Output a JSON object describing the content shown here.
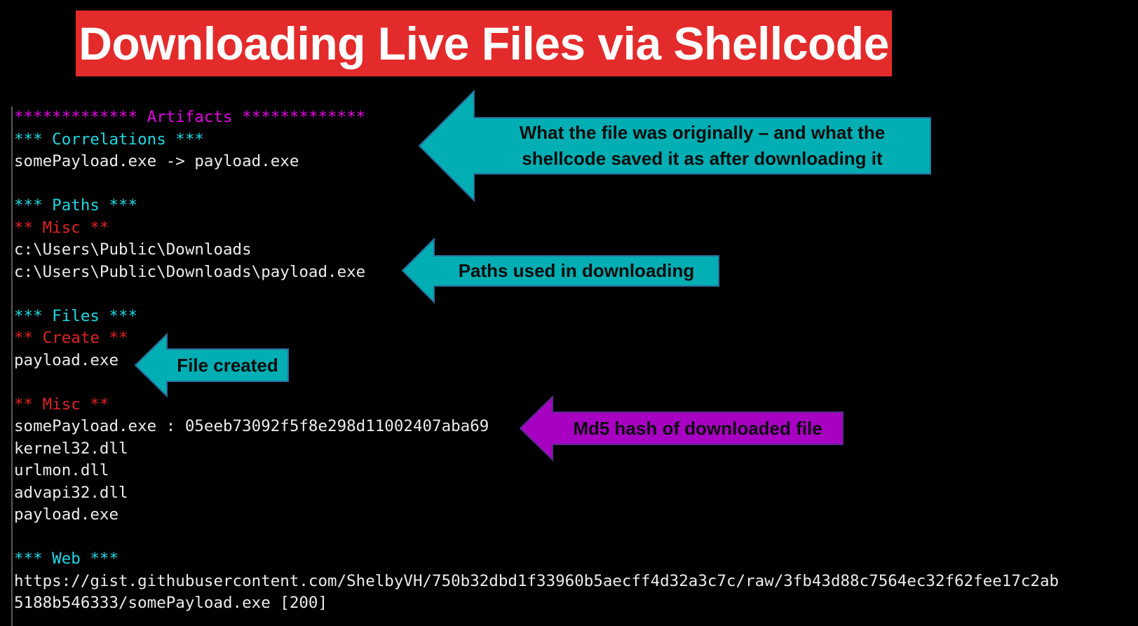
{
  "title": "Downloading Live Files via Shellcode",
  "colors": {
    "banner": "#e42b2b",
    "teal_callout": "#00aeb3",
    "purple_callout": "#a700c2",
    "console_magenta": "#e600e6",
    "console_cyan": "#1ed8e2",
    "console_red": "#e02424",
    "console_text": "#ececec"
  },
  "console": {
    "artifacts_header": "************* Artifacts *************",
    "correlations_header": "*** Correlations ***",
    "correlation_line": "somePayload.exe -> payload.exe",
    "paths_header": "*** Paths ***",
    "paths_misc_header": "** Misc **",
    "path_1": "c:\\Users\\Public\\Downloads",
    "path_2": "c:\\Users\\Public\\Downloads\\payload.exe",
    "files_header": "*** Files ***",
    "files_create_header": "** Create **",
    "created_file": "payload.exe",
    "files_misc_header": "** Misc **",
    "hash_line": "somePayload.exe : 05eeb73092f5f8e298d11002407aba69",
    "misc_1": "kernel32.dll",
    "misc_2": "urlmon.dll",
    "misc_3": "advapi32.dll",
    "misc_4": "payload.exe",
    "web_header": "*** Web ***",
    "url_line_1": "https://gist.githubusercontent.com/ShelbyVH/750b32dbd1f33960b5aecff4d32a3c7c/raw/3fb43d88c7564ec32f62fee17c2ab",
    "url_line_2": "5188b546333/somePayload.exe [200]"
  },
  "callouts": {
    "correlation_line_1": "What the file was originally – and what the",
    "correlation_line_2": "shellcode saved it as after downloading it",
    "paths": "Paths used in downloading",
    "file_created": "File created",
    "md5": "Md5 hash of downloaded file"
  }
}
